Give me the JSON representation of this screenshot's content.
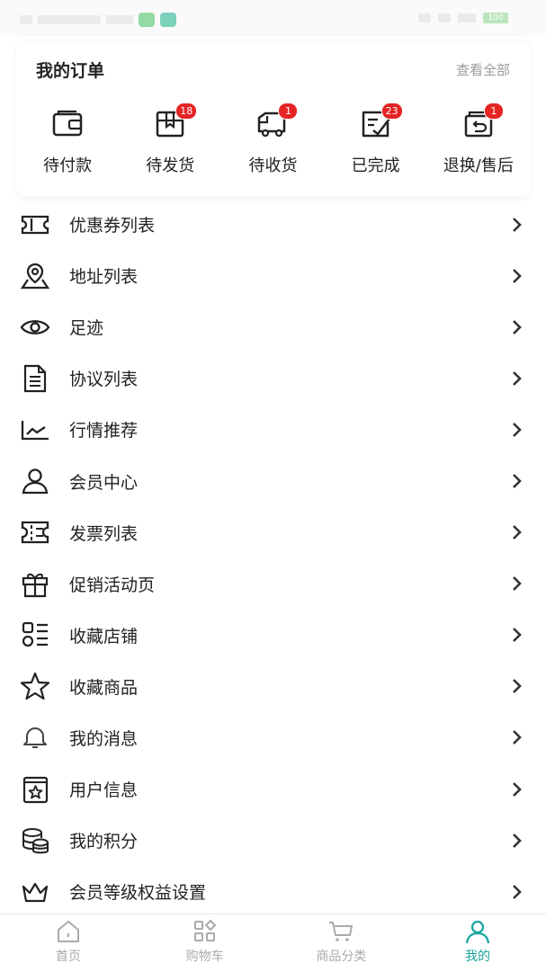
{
  "status_bar": {
    "battery": "100"
  },
  "orders": {
    "title": "我的订单",
    "view_all": "查看全部",
    "items": [
      {
        "label": "待付款",
        "icon": "wallet-icon",
        "badge": null
      },
      {
        "label": "待发货",
        "icon": "box-icon",
        "badge": "18"
      },
      {
        "label": "待收货",
        "icon": "truck-icon",
        "badge": "1"
      },
      {
        "label": "已完成",
        "icon": "checklist-icon",
        "badge": "23"
      },
      {
        "label": "退换/售后",
        "icon": "return-icon",
        "badge": "1"
      }
    ]
  },
  "menu": [
    {
      "label": "优惠券列表",
      "icon": "coupon-icon"
    },
    {
      "label": "地址列表",
      "icon": "location-icon"
    },
    {
      "label": "足迹",
      "icon": "eye-icon"
    },
    {
      "label": "协议列表",
      "icon": "document-icon"
    },
    {
      "label": "行情推荐",
      "icon": "trend-chart-icon"
    },
    {
      "label": "会员中心",
      "icon": "user-icon"
    },
    {
      "label": "发票列表",
      "icon": "invoice-icon"
    },
    {
      "label": "促销活动页",
      "icon": "gift-icon"
    },
    {
      "label": "收藏店铺",
      "icon": "store-list-icon"
    },
    {
      "label": "收藏商品",
      "icon": "star-icon"
    },
    {
      "label": "我的消息",
      "icon": "bell-icon"
    },
    {
      "label": "用户信息",
      "icon": "profile-card-icon"
    },
    {
      "label": "我的积分",
      "icon": "coins-icon"
    },
    {
      "label": "会员等级权益设置",
      "icon": "crown-icon"
    }
  ],
  "tabbar": {
    "tabs": [
      {
        "label": "首页",
        "icon": "home-icon",
        "active": false
      },
      {
        "label": "购物车",
        "icon": "grid-icon",
        "active": false
      },
      {
        "label": "商品分类",
        "icon": "cart-icon",
        "active": false
      },
      {
        "label": "我的",
        "icon": "user-icon",
        "active": true
      }
    ]
  },
  "colors": {
    "accent": "#1aa6a0",
    "badge": "#e52424",
    "text": "#222222",
    "muted": "#9a9a9a"
  }
}
